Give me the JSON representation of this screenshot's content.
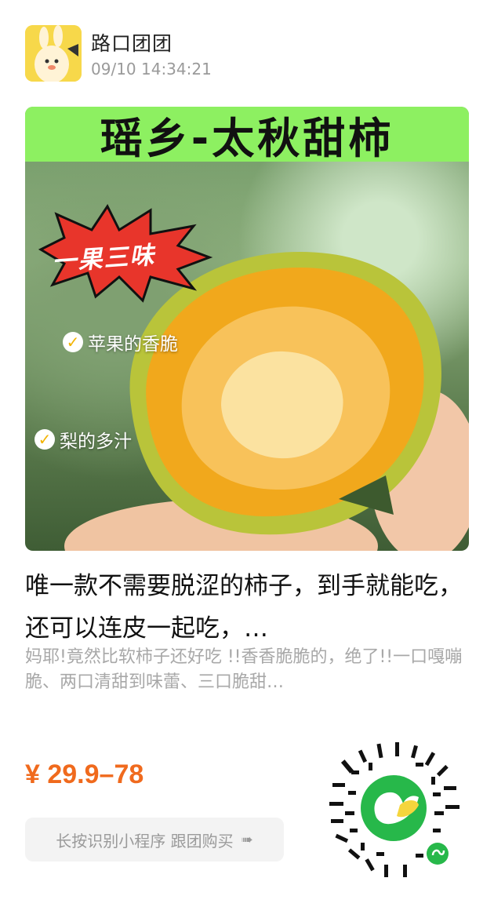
{
  "header": {
    "shop_name": "路口团团",
    "post_time": "09/10 14:34:21"
  },
  "product_image": {
    "banner_text": "瑶乡-太秋甜柿",
    "burst_text": "一果三味",
    "tags": [
      "苹果的香脆",
      "梨的多汁"
    ]
  },
  "product": {
    "title": "唯一款不需要脱涩的柿子，到手就能吃，还可以连皮一起吃，…",
    "description": "妈耶!竟然比软柿子还好吃 !!香香脆脆的，绝了!!一口嘎嘣脆、两口清甜到味蕾、三口脆甜…",
    "price": "¥ 29.9–78"
  },
  "action": {
    "label": "长按识别小程序 跟团购买"
  },
  "colors": {
    "price": "#f06a1d",
    "banner": "#8df061",
    "qr_center": "#27b84a"
  }
}
